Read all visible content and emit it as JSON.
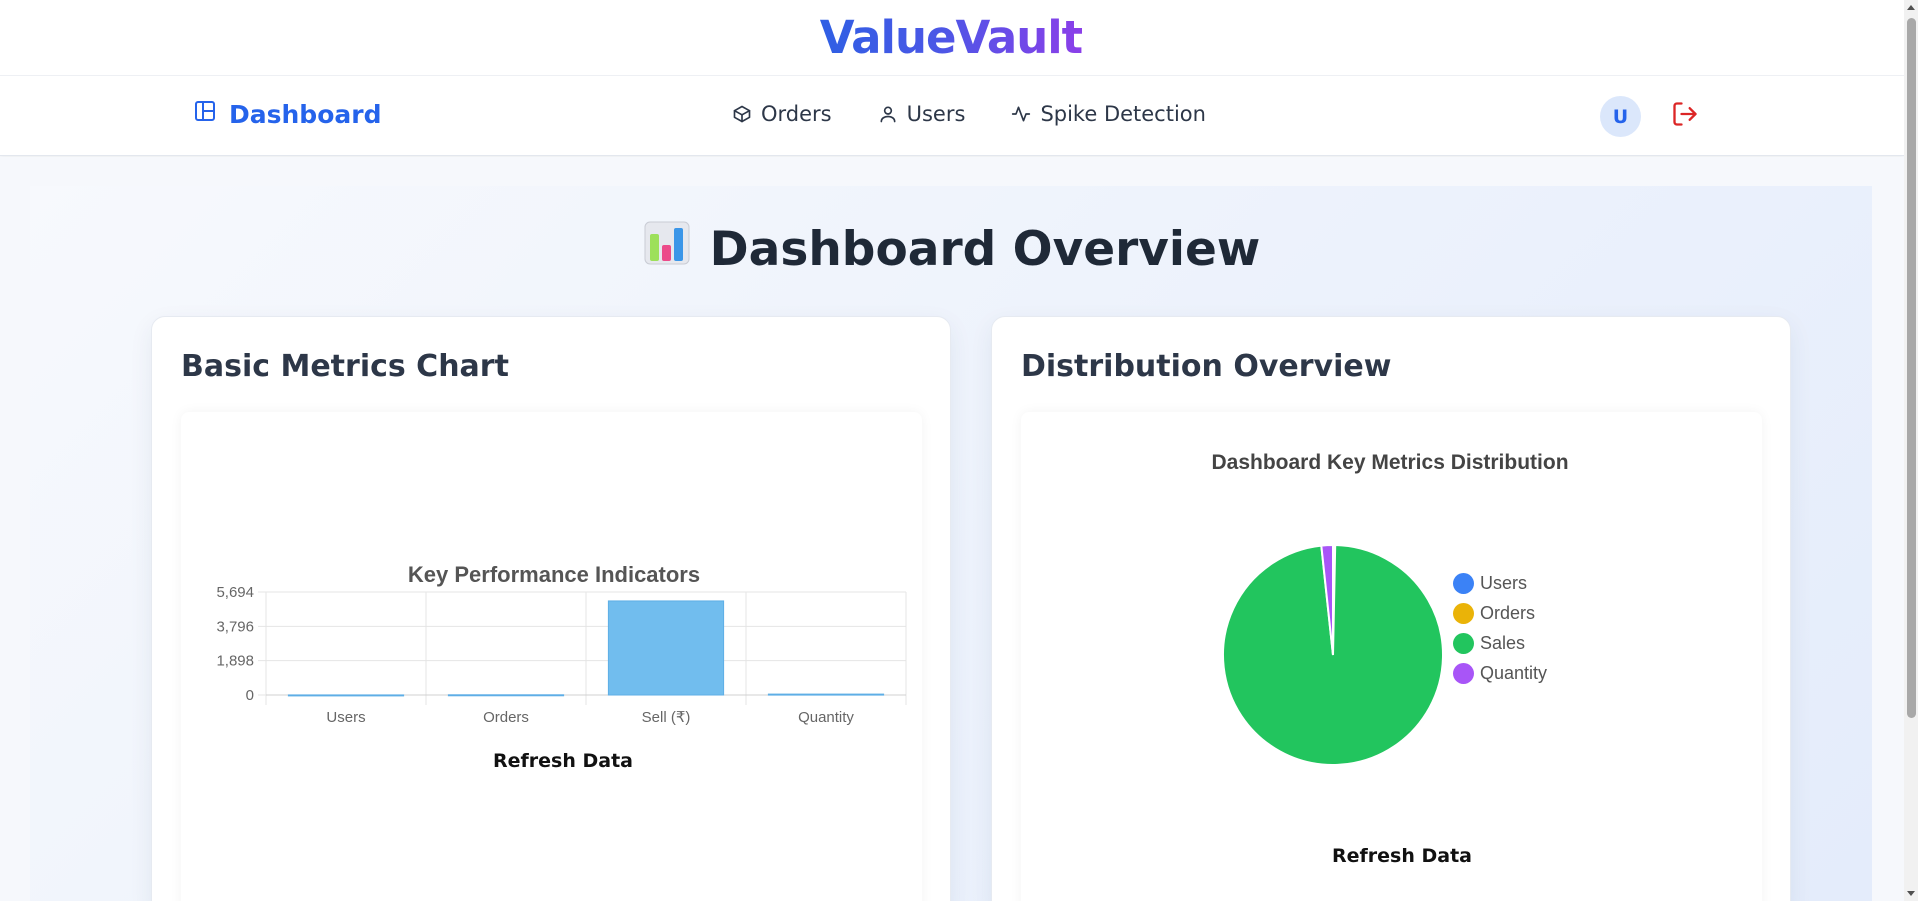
{
  "app": {
    "brand": "ValueVault"
  },
  "nav": {
    "home_label": "Dashboard",
    "items": [
      {
        "label": "Orders",
        "icon": "box-icon"
      },
      {
        "label": "Users",
        "icon": "user-icon"
      },
      {
        "label": "Spike Detection",
        "icon": "activity-icon"
      }
    ],
    "avatar_initial": "U",
    "logout_icon": "logout-icon"
  },
  "main": {
    "title_emoji": "📊",
    "title": "Dashboard Overview",
    "left_card": {
      "title": "Basic Metrics Chart",
      "refresh_label": "Refresh Data"
    },
    "right_card": {
      "title": "Distribution Overview",
      "refresh_label": "Refresh Data"
    }
  },
  "colors": {
    "accent": "#2563eb",
    "logout": "#dc2626",
    "bar": "#71bdee"
  },
  "chart_data": [
    {
      "type": "bar",
      "title": "Key Performance Indicators",
      "categories": [
        "Users",
        "Orders",
        "Sell (₹)",
        "Quantity"
      ],
      "values": [
        5,
        12,
        5200,
        50
      ],
      "ylim": [
        0,
        5694
      ],
      "yticks": [
        "5,694",
        "3,796",
        "1,898",
        "0"
      ],
      "grid": true,
      "legend": "none"
    },
    {
      "type": "pie",
      "title": "Dashboard Key Metrics Distribution",
      "labels": [
        "Users",
        "Orders",
        "Sales",
        "Quantity"
      ],
      "values": [
        5,
        12,
        5200,
        90
      ],
      "colors": [
        "#3b82f6",
        "#eab308",
        "#22c55e",
        "#a855f7"
      ],
      "legend": "right"
    }
  ]
}
